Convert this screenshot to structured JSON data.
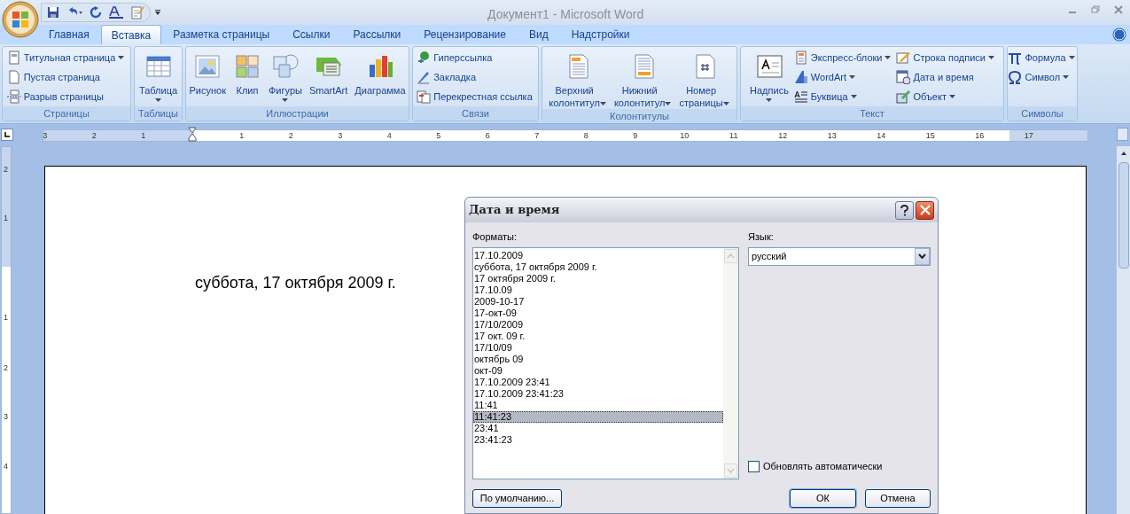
{
  "window": {
    "title": "Документ1 - Microsoft Word"
  },
  "tabs": [
    {
      "label": "Главная",
      "selected": false
    },
    {
      "label": "Вставка",
      "selected": true
    },
    {
      "label": "Разметка страницы",
      "selected": false
    },
    {
      "label": "Ссылки",
      "selected": false
    },
    {
      "label": "Рассылки",
      "selected": false
    },
    {
      "label": "Рецензирование",
      "selected": false
    },
    {
      "label": "Вид",
      "selected": false
    },
    {
      "label": "Надстройки",
      "selected": false
    }
  ],
  "ribbon_groups": [
    {
      "label": "Страницы",
      "columns": [
        {
          "kind": "stack",
          "items": [
            {
              "label": "Титульная страница",
              "dropdown": true
            },
            {
              "label": "Пустая страница",
              "dropdown": false
            },
            {
              "label": "Разрыв страницы",
              "dropdown": false
            }
          ]
        }
      ]
    },
    {
      "label": "Таблицы",
      "columns": [
        {
          "kind": "large",
          "label": "Таблица",
          "dropdown": true
        }
      ]
    },
    {
      "label": "Иллюстрации",
      "columns": [
        {
          "kind": "large",
          "label": "Рисунок",
          "dropdown": false
        },
        {
          "kind": "large",
          "label": "Клип",
          "dropdown": false
        },
        {
          "kind": "large",
          "label": "Фигуры",
          "dropdown": true
        },
        {
          "kind": "large",
          "label": "SmartArt",
          "dropdown": false
        },
        {
          "kind": "large",
          "label": "Диаграмма",
          "dropdown": false
        }
      ]
    },
    {
      "label": "Связи",
      "columns": [
        {
          "kind": "stack",
          "items": [
            {
              "label": "Гиперссылка",
              "dropdown": false
            },
            {
              "label": "Закладка",
              "dropdown": false
            },
            {
              "label": "Перекрестная ссылка",
              "dropdown": false
            }
          ]
        }
      ]
    },
    {
      "label": "Колонтитулы",
      "columns": [
        {
          "kind": "large",
          "label": "Верхний\nколонтитул",
          "dropdown": true
        },
        {
          "kind": "large",
          "label": "Нижний\nколонтитул",
          "dropdown": true
        },
        {
          "kind": "large",
          "label": "Номер\nстраницы",
          "dropdown": true
        }
      ]
    },
    {
      "label": "Текст",
      "columns": [
        {
          "kind": "large",
          "label": "Надпись",
          "dropdown": true
        },
        {
          "kind": "stack",
          "items": [
            {
              "label": "Экспресс-блоки",
              "dropdown": true
            },
            {
              "label": "WordArt",
              "dropdown": true
            },
            {
              "label": "Буквица",
              "dropdown": true
            }
          ]
        },
        {
          "kind": "stack",
          "items": [
            {
              "label": "Строка подписи",
              "dropdown": true
            },
            {
              "label": "Дата и время",
              "dropdown": false
            },
            {
              "label": "Объект",
              "dropdown": true
            }
          ]
        }
      ]
    },
    {
      "label": "Символы",
      "columns": [
        {
          "kind": "stack",
          "items": [
            {
              "label": "Формула",
              "dropdown": true
            },
            {
              "label": "Символ",
              "dropdown": true
            }
          ]
        }
      ]
    }
  ],
  "ruler": {
    "left_labels": [
      "3",
      "2",
      "1"
    ],
    "right_labels": [
      "1",
      "2",
      "3",
      "4",
      "5",
      "6",
      "7",
      "8",
      "9",
      "10",
      "11",
      "12",
      "13",
      "14",
      "15",
      "16",
      "17"
    ]
  },
  "vertical_ruler": [
    "2",
    "1",
    "1",
    "2",
    "3",
    "4"
  ],
  "document": {
    "text": "суббота, 17 октября 2009 г."
  },
  "dialog": {
    "title": "Дата и время",
    "formats_label": "Форматы:",
    "formats": [
      {
        "text": "17.10.2009",
        "selected": false
      },
      {
        "text": "суббота, 17 октября 2009 г.",
        "selected": false
      },
      {
        "text": "17 октября 2009 г.",
        "selected": false
      },
      {
        "text": "17.10.09",
        "selected": false
      },
      {
        "text": "2009-10-17",
        "selected": false
      },
      {
        "text": "17-окт-09",
        "selected": false
      },
      {
        "text": "17/10/2009",
        "selected": false
      },
      {
        "text": "17 окт. 09 г.",
        "selected": false
      },
      {
        "text": "17/10/09",
        "selected": false
      },
      {
        "text": "октябрь 09",
        "selected": false
      },
      {
        "text": "окт-09",
        "selected": false
      },
      {
        "text": "17.10.2009 23:41",
        "selected": false
      },
      {
        "text": "17.10.2009 23:41:23",
        "selected": false
      },
      {
        "text": "11:41",
        "selected": false
      },
      {
        "text": "11:41:23",
        "selected": true
      },
      {
        "text": "23:41",
        "selected": false
      },
      {
        "text": "23:41:23",
        "selected": false
      }
    ],
    "language_label": "Язык:",
    "language": "русский",
    "auto_update": {
      "label": "Обновлять автоматически",
      "checked": false
    },
    "buttons": {
      "default": "По умолчанию...",
      "ok": "ОК",
      "cancel": "Отмена"
    }
  }
}
